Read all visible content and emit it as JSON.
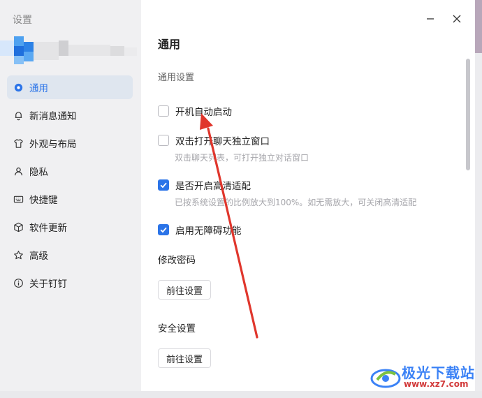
{
  "sidebar": {
    "title": "设置",
    "items": [
      {
        "label": "通用",
        "icon": "gear-icon",
        "active": true
      },
      {
        "label": "新消息通知",
        "icon": "bell-icon",
        "active": false
      },
      {
        "label": "外观与布局",
        "icon": "shirt-icon",
        "active": false
      },
      {
        "label": "隐私",
        "icon": "person-icon",
        "active": false
      },
      {
        "label": "快捷键",
        "icon": "keyboard-icon",
        "active": false
      },
      {
        "label": "软件更新",
        "icon": "cube-icon",
        "active": false
      },
      {
        "label": "高级",
        "icon": "star-icon",
        "active": false
      },
      {
        "label": "关于钉钉",
        "icon": "info-icon",
        "active": false
      }
    ]
  },
  "content": {
    "title": "通用",
    "general_section": "通用设置",
    "options": [
      {
        "label": "开机自动启动",
        "checked": false,
        "desc": ""
      },
      {
        "label": "双击打开聊天独立窗口",
        "checked": false,
        "desc": "双击聊天列表，可打开独立对话窗口"
      },
      {
        "label": "是否开启高清适配",
        "checked": true,
        "desc": "已按系统设置的比例放大到100%。如无需放大，可关闭高清适配"
      },
      {
        "label": "启用无障碍功能",
        "checked": true,
        "desc": ""
      }
    ],
    "password_section": "修改密码",
    "password_button": "前往设置",
    "security_section": "安全设置",
    "security_button": "前往设置"
  },
  "window_controls": {
    "minimize": "minimize-icon",
    "close": "close-icon"
  },
  "watermark": {
    "title": "极光下载站",
    "url": "www.xz7.com"
  },
  "colors": {
    "accent": "#2b74e8",
    "arrow": "#e0362c",
    "sidebar_bg": "#f0f0f2",
    "active_bg": "#dfe6ef"
  }
}
